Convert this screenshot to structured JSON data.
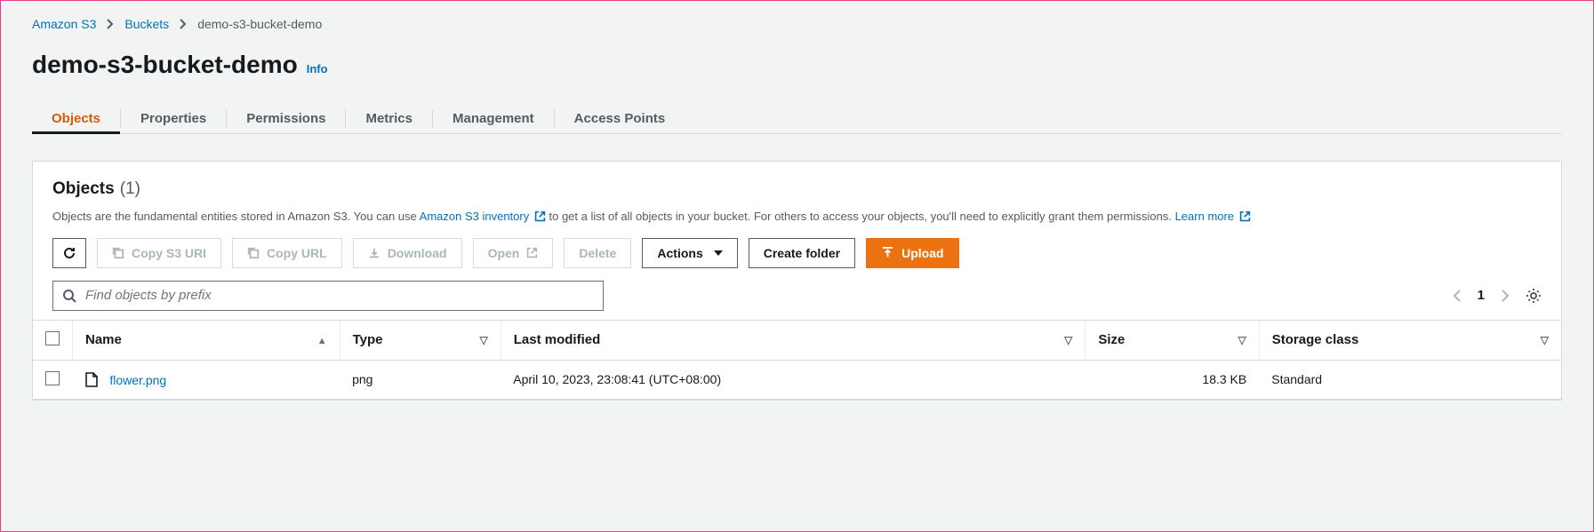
{
  "breadcrumb": {
    "root": "Amazon S3",
    "buckets": "Buckets",
    "current": "demo-s3-bucket-demo"
  },
  "header": {
    "title": "demo-s3-bucket-demo",
    "info": "Info"
  },
  "tabs": {
    "objects": "Objects",
    "properties": "Properties",
    "permissions": "Permissions",
    "metrics": "Metrics",
    "management": "Management",
    "access_points": "Access Points"
  },
  "panel": {
    "title": "Objects",
    "count": "(1)",
    "desc_prefix": "Objects are the fundamental entities stored in Amazon S3. You can use ",
    "inventory_link": "Amazon S3 inventory",
    "desc_mid": " to get a list of all objects in your bucket. For others to access your objects, you'll need to explicitly grant them permissions. ",
    "learn_more": "Learn more"
  },
  "toolbar": {
    "copy_s3_uri": "Copy S3 URI",
    "copy_url": "Copy URL",
    "download": "Download",
    "open": "Open",
    "delete": "Delete",
    "actions": "Actions",
    "create_folder": "Create folder",
    "upload": "Upload"
  },
  "search": {
    "placeholder": "Find objects by prefix"
  },
  "pager": {
    "page": "1"
  },
  "table": {
    "headers": {
      "name": "Name",
      "type": "Type",
      "last_modified": "Last modified",
      "size": "Size",
      "storage_class": "Storage class"
    },
    "rows": [
      {
        "name": "flower.png",
        "type": "png",
        "last_modified": "April 10, 2023, 23:08:41 (UTC+08:00)",
        "size": "18.3 KB",
        "storage_class": "Standard"
      }
    ]
  }
}
